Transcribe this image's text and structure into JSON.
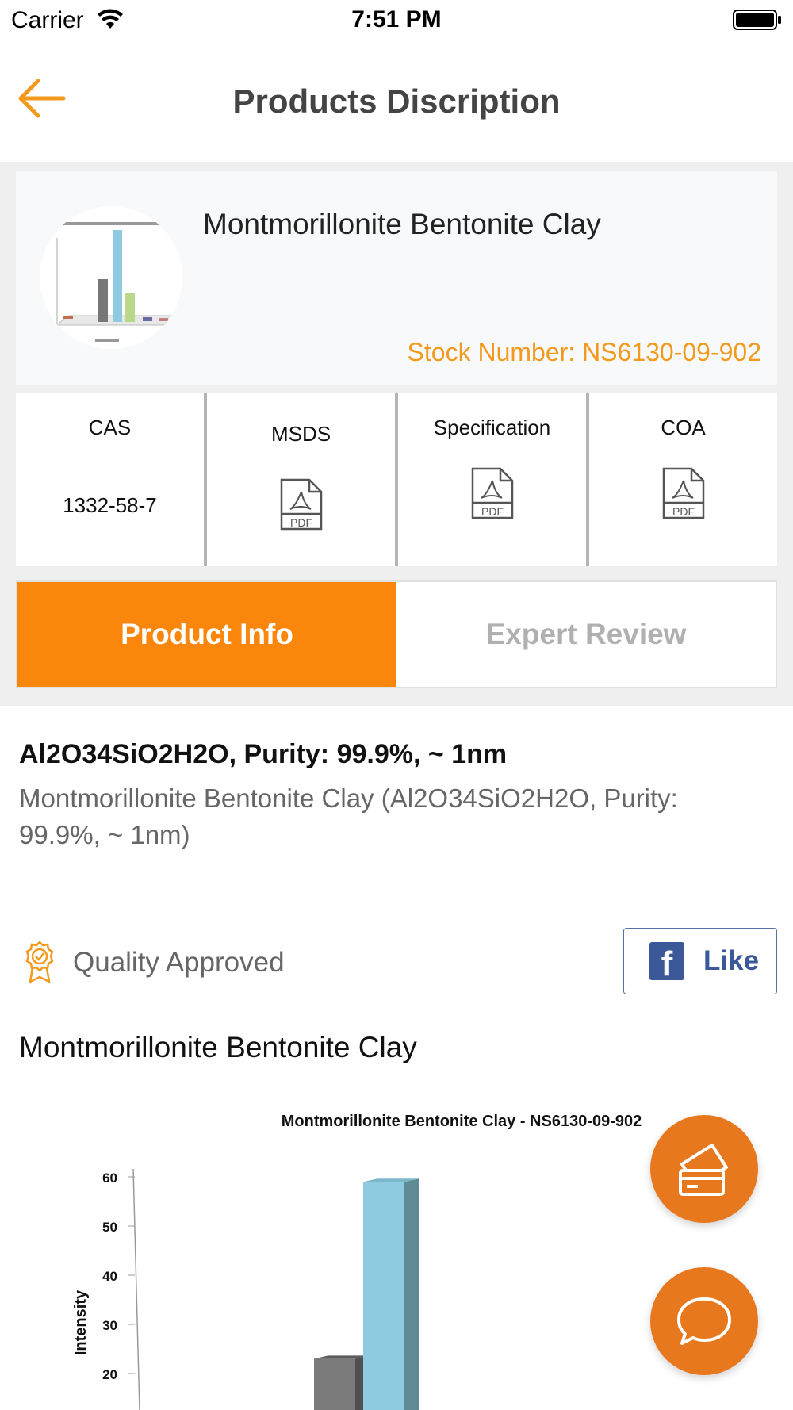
{
  "status_bar": {
    "carrier": "Carrier",
    "time": "7:51 PM"
  },
  "nav": {
    "title": "Products Discription"
  },
  "product": {
    "name": "Montmorillonite Bentonite Clay",
    "stock_number": "Stock Number: NS6130-09-902"
  },
  "docs": {
    "cas_label": "CAS",
    "cas_value": "1332-58-7",
    "msds_label": "MSDS",
    "spec_label": "Specification",
    "coa_label": "COA",
    "pdf_text": "PDF"
  },
  "tabs": {
    "product_info": "Product Info",
    "expert_review": "Expert Review"
  },
  "content": {
    "purity_title": "Al2O34SiO2H2O, Purity: 99.9%, ~ 1nm",
    "description": "Montmorillonite Bentonite Clay (Al2O34SiO2H2O, Purity: 99.9%, ~ 1nm)",
    "quality_label": "Quality Approved",
    "like_label": "Like",
    "section_title": "Montmorillonite Bentonite Clay"
  },
  "colors": {
    "accent": "#fa860c",
    "stock": "#f39a1e",
    "fab": "#e8781e",
    "facebook": "#3b5998"
  },
  "chart_data": {
    "type": "bar",
    "title": "Montmorillonite Bentonite Clay - NS6130-09-902",
    "ylabel": "Intensity",
    "xlabel": "",
    "ylim": [
      0,
      60
    ],
    "yticks": [
      60,
      50,
      40,
      30,
      20
    ],
    "bars": [
      {
        "color": "#7a7a7a",
        "value": 23
      },
      {
        "color": "#8fcbe0",
        "value": 59
      }
    ]
  }
}
